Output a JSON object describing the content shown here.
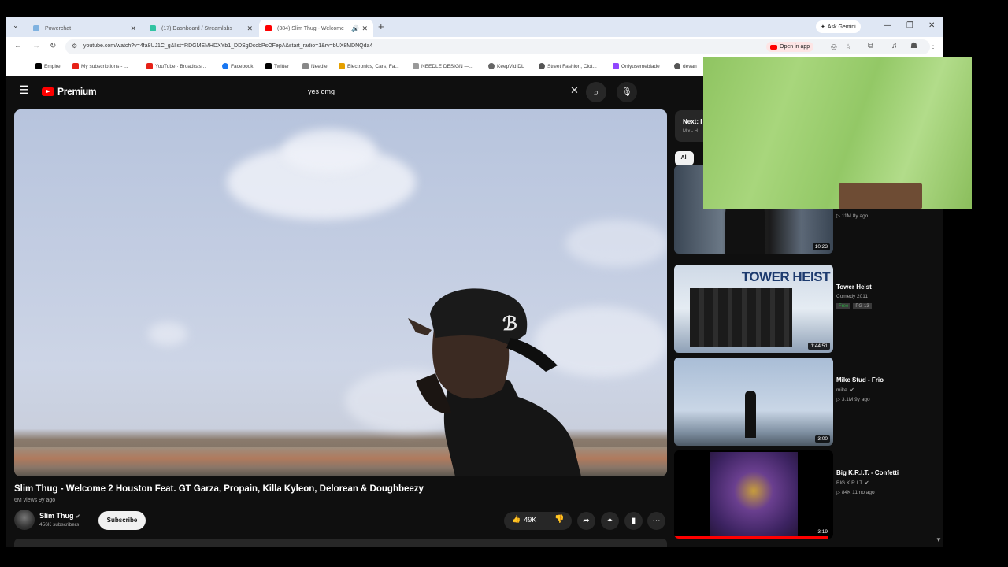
{
  "browser": {
    "tabs": [
      {
        "title": "Powerchat",
        "favicon_color": "#7fb2e0"
      },
      {
        "title": "(17) Dashboard / Streamlabs",
        "favicon_color": "#31c3a2"
      },
      {
        "title": "(384) Slim Thug - Welcome",
        "favicon_color": "#ff0000"
      }
    ],
    "gemini_label": "Ask Gemini",
    "url": "youtube.com/watch?v=4fa8UJ1C_g&list=RDGMEMHDXYb1_DDSgDcobPsOFepA&start_radio=1&rv=bUX8MDNQda4",
    "open_in_app_label": "Open in app"
  },
  "bookmarks": [
    {
      "label": "Empire",
      "color": "#000000"
    },
    {
      "label": "My subscriptions - ...",
      "color": "#e62117"
    },
    {
      "label": "YouTube · Broadcas...",
      "color": "#e62117"
    },
    {
      "label": "Facebook",
      "color": "#1877f2"
    },
    {
      "label": "Twitter",
      "color": "#000000"
    },
    {
      "label": "Needle",
      "color": "#888888"
    },
    {
      "label": "Electronics, Cars, Fa...",
      "color": "#e5a000"
    },
    {
      "label": "NEEDLE DESIGN —...",
      "color": "#999999"
    },
    {
      "label": "KeepVid DL",
      "color": "#666666"
    },
    {
      "label": "Street Fashion, Clot...",
      "color": "#555555"
    },
    {
      "label": "Onlyusemeblade",
      "color": "#9146ff"
    },
    {
      "label": "devan",
      "color": "#555555"
    }
  ],
  "youtube": {
    "logo_text": "Premium",
    "search_query": "yes omg",
    "video": {
      "title": "Slim Thug - Welcome 2 Houston Feat. GT Garza, Propain, Killa Kyleon, Delorean & Doughbeezy",
      "meta": "6M views  9y ago",
      "channel": "Slim Thug",
      "subscribers": "456K subscribers",
      "subscribe_label": "Subscribe",
      "likes": "49K"
    },
    "up_next": {
      "label": "Next: I",
      "sub": "Mix - H"
    },
    "chip_all": "All",
    "recommendations": [
      {
        "title": "",
        "lines": [
          "11M  8y ago"
        ],
        "duration": "10:23"
      },
      {
        "title": "Tower Heist",
        "lines": [
          "Comedy 2011"
        ],
        "badges": [
          "Free",
          "PG-13"
        ],
        "duration": "1:44:51",
        "thumb_text": "TOWER HEIST"
      },
      {
        "title": "Mike Stud - Frio",
        "lines": [
          "mike.",
          "3.1M  9y ago"
        ],
        "duration": "3:00"
      },
      {
        "title": "Big K.R.I.T. - Confetti",
        "lines": [
          "BIG K.R.I.T.",
          "84K  11mo ago"
        ],
        "duration": "3:19"
      }
    ]
  }
}
